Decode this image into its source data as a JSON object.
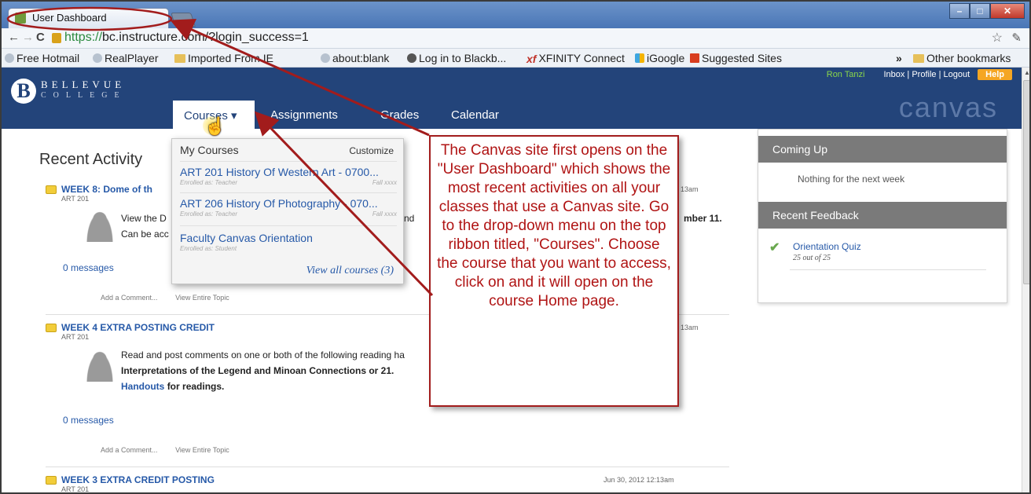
{
  "browser": {
    "tab_title": "User Dashboard",
    "url_https": "https://",
    "url_rest": "bc.instructure.com/?login_success=1",
    "window_buttons": [
      "–",
      "□",
      "✕"
    ]
  },
  "bookmarks": [
    {
      "label": "Free Hotmail",
      "icon": "globe-icon"
    },
    {
      "label": "RealPlayer",
      "icon": "globe-icon"
    },
    {
      "label": "Imported From IE",
      "icon": "folder-icon"
    },
    {
      "label": "about:blank",
      "icon": "globe-icon"
    },
    {
      "label": "Log in to Blackb...",
      "icon": "person-icon"
    },
    {
      "label": "XFINITY Connect",
      "icon": "xfinity-icon"
    },
    {
      "label": "iGoogle",
      "icon": "igoogle-icon"
    },
    {
      "label": "Suggested Sites",
      "icon": "suggested-icon"
    },
    {
      "label": "»",
      "icon": ""
    },
    {
      "label": "Other bookmarks",
      "icon": "folder-icon"
    }
  ],
  "header": {
    "logo_top": "BELLEVUE",
    "logo_bottom": "COLLEGE",
    "logo_letter": "B",
    "nav": [
      "Courses ▾",
      "Assignments",
      "Grades",
      "Calendar"
    ],
    "user_name": "Ron Tanzi",
    "links": "Inbox | Profile | Logout",
    "help": "Help",
    "brand": "canvas"
  },
  "main": {
    "title": "Recent Activity",
    "activities": [
      {
        "title": "WEEK 8: Dome of th",
        "course": "ART 201",
        "date": "13am",
        "body_line1_pre": "View the D",
        "body_line1_mid": "s and",
        "body_line1_end": "mber 11.",
        "body_line2": "Can be acc",
        "messages": "0 messages",
        "action1": "Add a Comment...",
        "action2": "View Entire Topic"
      },
      {
        "title": "WEEK 4 EXTRA POSTING CREDIT",
        "course": "ART 201",
        "date": "13am",
        "body_line1": "Read and post comments on one or both of the following reading ha",
        "body_line2": "Interpretations of the Legend and Minoan Connections or 21.",
        "body_line3_link": "Handouts",
        "body_line3_rest": "for readings.",
        "messages": "0 messages",
        "action1": "Add a Comment...",
        "action2": "View Entire Topic"
      },
      {
        "title": "WEEK 3 EXTRA CREDIT POSTING",
        "course": "ART 201",
        "date": "Jun 30, 2012 12:13am"
      }
    ]
  },
  "dropdown": {
    "heading": "My Courses",
    "customize": "Customize",
    "items": [
      {
        "name": "ART 201 History Of Western Art - 0700...",
        "role": "Enrolled as: Teacher",
        "term": "Fall xxxx"
      },
      {
        "name": "ART 206 History Of Photography - 070...",
        "role": "Enrolled as: Teacher",
        "term": "Fall xxxx"
      },
      {
        "name": "Faculty Canvas Orientation",
        "role": "Enrolled as: Student",
        "term": ""
      }
    ],
    "view_all": "View all courses (3)"
  },
  "sidebar": {
    "coming_up": "Coming Up",
    "nothing": "Nothing for the next week",
    "recent_feedback": "Recent Feedback",
    "quiz": "Orientation Quiz",
    "score": "25 out of 25"
  },
  "callout": {
    "text": "The Canvas site first opens on the \"User Dashboard\" which shows the most recent activities on all your classes that use a Canvas site. Go to the drop-down menu on the top ribbon titled, \"Courses\". Choose the course that you want to access, click on and it will open on the course Home page."
  },
  "colors": {
    "header_blue": "#23447a",
    "link_blue": "#2659a8",
    "annotation_red": "#a21c1c",
    "help_orange": "#f5a623",
    "sidebar_head": "#7a7a7a"
  }
}
